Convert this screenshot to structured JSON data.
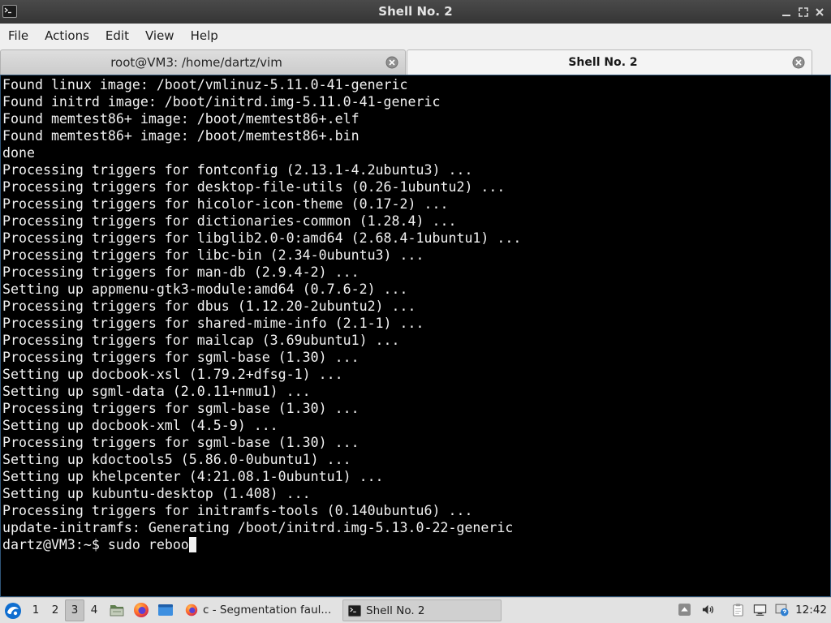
{
  "window": {
    "title": "Shell No. 2",
    "icon": "terminal-icon",
    "controls": [
      "minimize-icon",
      "maximize-icon",
      "close-icon"
    ]
  },
  "menu": {
    "items": [
      "File",
      "Actions",
      "Edit",
      "View",
      "Help"
    ]
  },
  "tabs": [
    {
      "label": "root@VM3: /home/dartz/vim",
      "active": false
    },
    {
      "label": "Shell No. 2",
      "active": true
    }
  ],
  "terminal": {
    "lines": [
      "Found linux image: /boot/vmlinuz-5.11.0-41-generic",
      "Found initrd image: /boot/initrd.img-5.11.0-41-generic",
      "Found memtest86+ image: /boot/memtest86+.elf",
      "Found memtest86+ image: /boot/memtest86+.bin",
      "done",
      "Processing triggers for fontconfig (2.13.1-4.2ubuntu3) ...",
      "Processing triggers for desktop-file-utils (0.26-1ubuntu2) ...",
      "Processing triggers for hicolor-icon-theme (0.17-2) ...",
      "Processing triggers for dictionaries-common (1.28.4) ...",
      "Processing triggers for libglib2.0-0:amd64 (2.68.4-1ubuntu1) ...",
      "Processing triggers for libc-bin (2.34-0ubuntu3) ...",
      "Processing triggers for man-db (2.9.4-2) ...",
      "Setting up appmenu-gtk3-module:amd64 (0.7.6-2) ...",
      "Processing triggers for dbus (1.12.20-2ubuntu2) ...",
      "Processing triggers for shared-mime-info (2.1-1) ...",
      "Processing triggers for mailcap (3.69ubuntu1) ...",
      "Processing triggers for sgml-base (1.30) ...",
      "Setting up docbook-xsl (1.79.2+dfsg-1) ...",
      "Setting up sgml-data (2.0.11+nmu1) ...",
      "Processing triggers for sgml-base (1.30) ...",
      "Setting up docbook-xml (4.5-9) ...",
      "Processing triggers for sgml-base (1.30) ...",
      "Setting up kdoctools5 (5.86.0-0ubuntu1) ...",
      "Setting up khelpcenter (4:21.08.1-0ubuntu1) ...",
      "Setting up kubuntu-desktop (1.408) ...",
      "Processing triggers for initramfs-tools (0.140ubuntu6) ...",
      "update-initramfs: Generating /boot/initrd.img-5.13.0-22-generic"
    ],
    "prompt": "dartz@VM3:~$",
    "command": "sudo reboo"
  },
  "taskbar": {
    "start_icon": "lubuntu-logo-icon",
    "workspaces": [
      {
        "label": "1",
        "active": false
      },
      {
        "label": "2",
        "active": false
      },
      {
        "label": "3",
        "active": true
      },
      {
        "label": "4",
        "active": false
      }
    ],
    "launchers": [
      "file-manager-icon",
      "firefox-icon",
      "show-desktop-icon"
    ],
    "tasks": [
      {
        "label": "c - Segmentation faul...",
        "icon": "firefox-icon",
        "active": false
      },
      {
        "label": "Shell No. 2",
        "icon": "terminal-icon",
        "active": true
      }
    ],
    "tray": [
      "tray-expand-icon",
      "volume-icon",
      "clipboard-icon",
      "network-icon",
      "update-notifier-icon"
    ],
    "clock": "12:42"
  },
  "colors": {
    "titlebar": "#353535",
    "menubar": "#efefef",
    "terminal_bg": "#000000",
    "terminal_fg": "#f2f2f2",
    "taskbar": "#e2e2e2"
  }
}
